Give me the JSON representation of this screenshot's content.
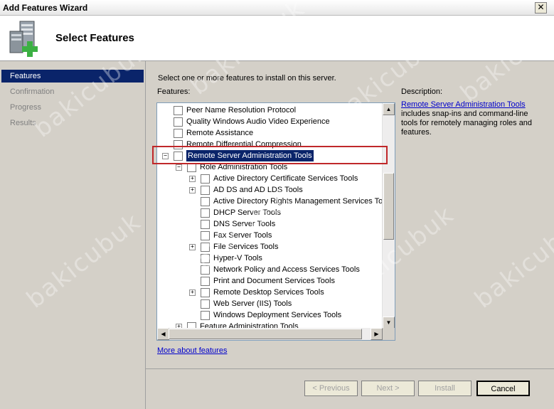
{
  "window": {
    "title": "Add Features Wizard",
    "close_glyph": "✕"
  },
  "header": {
    "title": "Select Features"
  },
  "nav": [
    "Features",
    "Confirmation",
    "Progress",
    "Results"
  ],
  "content": {
    "intro": "Select one or more features to install on this server.",
    "features_label": "Features:",
    "description_label": "Description:",
    "description_link": "Remote Server Administration Tools",
    "description_text": "includes snap-ins and command-line tools for remotely managing roles and features.",
    "more_link": "More about features"
  },
  "tree": [
    {
      "label": "Peer Name Resolution Protocol",
      "level": 0,
      "expander": "",
      "checked": false,
      "selected": false
    },
    {
      "label": "Quality Windows Audio Video Experience",
      "level": 0,
      "expander": "",
      "checked": false,
      "selected": false
    },
    {
      "label": "Remote Assistance",
      "level": 0,
      "expander": "",
      "checked": false,
      "selected": false
    },
    {
      "label": "Remote Differential Compression",
      "level": 0,
      "expander": "",
      "checked": false,
      "selected": false
    },
    {
      "label": "Remote Server Administration Tools",
      "level": 0,
      "expander": "−",
      "checked": false,
      "selected": true
    },
    {
      "label": "Role Administration Tools",
      "level": 1,
      "expander": "−",
      "checked": false,
      "selected": false
    },
    {
      "label": "Active Directory Certificate Services Tools",
      "level": 2,
      "expander": "+",
      "checked": false,
      "selected": false
    },
    {
      "label": "AD DS and AD LDS Tools",
      "level": 2,
      "expander": "+",
      "checked": false,
      "selected": false
    },
    {
      "label": "Active Directory Rights Management Services Tools",
      "level": 2,
      "expander": "",
      "checked": false,
      "selected": false
    },
    {
      "label": "DHCP Server Tools",
      "level": 2,
      "expander": "",
      "checked": false,
      "selected": false
    },
    {
      "label": "DNS Server Tools",
      "level": 2,
      "expander": "",
      "checked": false,
      "selected": false
    },
    {
      "label": "Fax Server Tools",
      "level": 2,
      "expander": "",
      "checked": false,
      "selected": false
    },
    {
      "label": "File Services Tools",
      "level": 2,
      "expander": "+",
      "checked": false,
      "selected": false
    },
    {
      "label": "Hyper-V Tools",
      "level": 2,
      "expander": "",
      "checked": false,
      "selected": false
    },
    {
      "label": "Network Policy and Access Services Tools",
      "level": 2,
      "expander": "",
      "checked": false,
      "selected": false
    },
    {
      "label": "Print and Document Services Tools",
      "level": 2,
      "expander": "",
      "checked": false,
      "selected": false
    },
    {
      "label": "Remote Desktop Services Tools",
      "level": 2,
      "expander": "+",
      "checked": false,
      "selected": false
    },
    {
      "label": "Web Server (IIS) Tools",
      "level": 2,
      "expander": "",
      "checked": false,
      "selected": false
    },
    {
      "label": "Windows Deployment Services Tools",
      "level": 2,
      "expander": "",
      "checked": false,
      "selected": false
    },
    {
      "label": "Feature Administration Tools",
      "level": 1,
      "expander": "+",
      "checked": false,
      "selected": false
    }
  ],
  "buttons": {
    "previous": "< Previous",
    "next": "Next >",
    "install": "Install",
    "cancel": "Cancel"
  },
  "watermark": "bakicubuk"
}
